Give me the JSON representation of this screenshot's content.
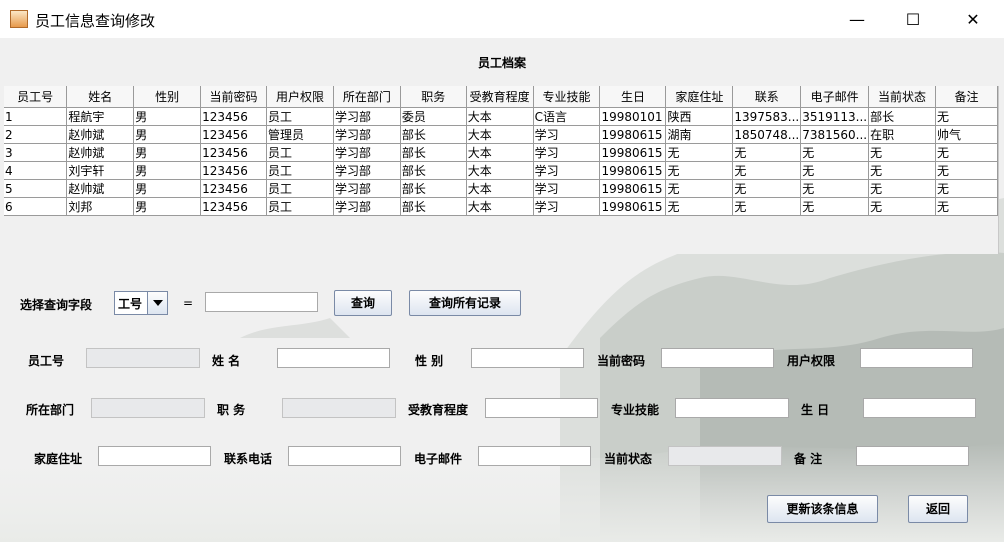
{
  "window": {
    "title": "员工信息查询修改",
    "minimize": "—",
    "maximize": "☐",
    "close": "✕"
  },
  "caption": "员工档案",
  "table": {
    "columns": [
      "员工号",
      "姓名",
      "性别",
      "当前密码",
      "用户权限",
      "所在部门",
      "职务",
      "受教育程度",
      "专业技能",
      "生日",
      "家庭住址",
      "联系",
      "电子邮件",
      "当前状态",
      "备注"
    ],
    "rows": [
      [
        "1",
        "程航宇",
        "男",
        "123456",
        "员工",
        "学习部",
        "委员",
        "大本",
        "C语言",
        "19980101",
        "陕西",
        "1397583...",
        "3519113...",
        "部长",
        "无"
      ],
      [
        "2",
        "赵帅斌",
        "男",
        "123456",
        "管理员",
        "学习部",
        "部长",
        "大本",
        "学习",
        "19980615",
        "湖南",
        "1850748...",
        "7381560...",
        "在职",
        "帅气"
      ],
      [
        "3",
        "赵帅斌",
        "男",
        "123456",
        "员工",
        "学习部",
        "部长",
        "大本",
        "学习",
        "19980615",
        "无",
        "无",
        "无",
        "无",
        "无"
      ],
      [
        "4",
        "刘宇轩",
        "男",
        "123456",
        "员工",
        "学习部",
        "部长",
        "大本",
        "学习",
        "19980615",
        "无",
        "无",
        "无",
        "无",
        "无"
      ],
      [
        "5",
        "赵帅斌",
        "男",
        "123456",
        "员工",
        "学习部",
        "部长",
        "大本",
        "学习",
        "19980615",
        "无",
        "无",
        "无",
        "无",
        "无"
      ],
      [
        "6",
        "刘邦",
        "男",
        "123456",
        "员工",
        "学习部",
        "部长",
        "大本",
        "学习",
        "19980615",
        "无",
        "无",
        "无",
        "无",
        "无"
      ]
    ]
  },
  "query": {
    "label": "选择查询字段",
    "field_value": "工号",
    "equals": "=",
    "value": "",
    "query_button": "查询",
    "all_button": "查询所有记录"
  },
  "form": {
    "emp_no_label": "员工号",
    "name_label": "姓 名",
    "gender_label": "性 别",
    "password_label": "当前密码",
    "permission_label": "用户权限",
    "dept_label": "所在部门",
    "title_label": "职 务",
    "education_label": "受教育程度",
    "skill_label": "专业技能",
    "birthday_label": "生 日",
    "address_label": "家庭住址",
    "phone_label": "联系电话",
    "email_label": "电子邮件",
    "status_label": "当前状态",
    "note_label": "备 注",
    "emp_no": "",
    "name": "",
    "gender": "",
    "password": "",
    "permission": "",
    "dept": "",
    "title": "",
    "education": "",
    "skill": "",
    "birthday": "",
    "address": "",
    "phone": "",
    "email": "",
    "status": "",
    "note": ""
  },
  "actions": {
    "update_button": "更新该条信息",
    "back_button": "返回"
  }
}
